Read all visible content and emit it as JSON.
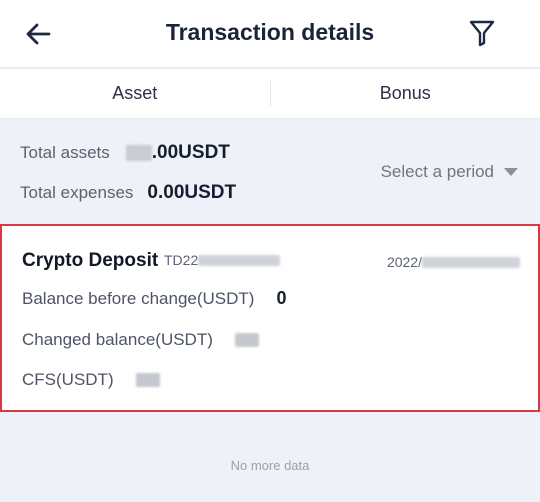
{
  "header": {
    "title": "Transaction details",
    "back_icon": "back-arrow-icon",
    "filter_icon": "filter-icon"
  },
  "tabs": [
    {
      "label": "Asset"
    },
    {
      "label": "Bonus"
    }
  ],
  "summary": {
    "total_assets_label": "Total assets",
    "total_assets_value": ".00USDT",
    "total_expenses_label": "Total expenses",
    "total_expenses_value": "0.00USDT",
    "period_label": "Select a period"
  },
  "transaction": {
    "type": "Crypto Deposit",
    "id_prefix": "TD22",
    "date_prefix": "2022/",
    "balance_before_label": "Balance before change(USDT)",
    "balance_before_value": "0",
    "changed_balance_label": "Changed balance(USDT)",
    "cfs_label": "CFS(USDT)",
    "highlight_color": "#d73a45"
  },
  "footer": {
    "text": "No more data"
  }
}
